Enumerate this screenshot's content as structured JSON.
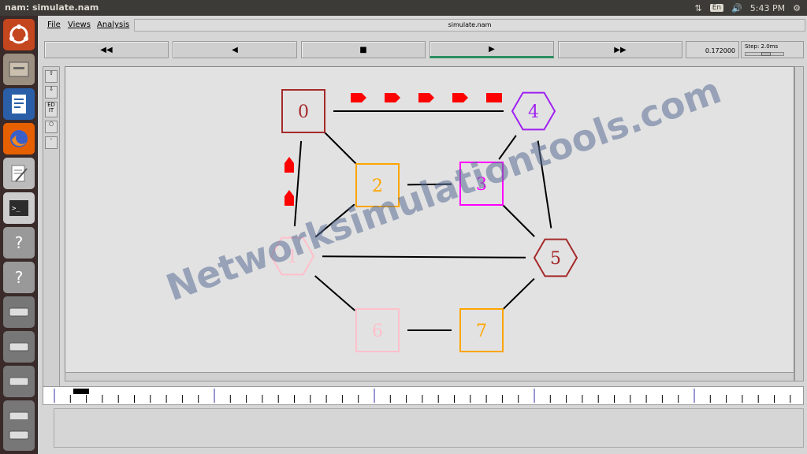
{
  "window_title": "nam: simulate.nam",
  "tray": {
    "keyboard": "En",
    "clock": "5:43 PM"
  },
  "menu": {
    "file": "File",
    "views": "Views",
    "analysis": "Analysis"
  },
  "file_label": "simulate.nam",
  "toolbar": {
    "rewind": "◀◀",
    "back": "◀",
    "stop": "■",
    "play": "▶",
    "fast_forward": "▶▶"
  },
  "time_value": "0.172000",
  "step_label": "Step: 2.0ms",
  "side_tools": {
    "edit": "ED IT"
  },
  "nodes": [
    {
      "id": "0",
      "shape": "square",
      "color": "#a52a2a"
    },
    {
      "id": "1",
      "shape": "hexagon",
      "color": "#ffc0cb"
    },
    {
      "id": "2",
      "shape": "square",
      "color": "#ffa500"
    },
    {
      "id": "3",
      "shape": "square",
      "color": "#ff00ff"
    },
    {
      "id": "4",
      "shape": "hexagon",
      "color": "#a020f0"
    },
    {
      "id": "5",
      "shape": "hexagon",
      "color": "#a52a2a"
    },
    {
      "id": "6",
      "shape": "square",
      "color": "#ffc0cb"
    },
    {
      "id": "7",
      "shape": "square",
      "color": "#ffa500"
    }
  ],
  "links": [
    [
      "0",
      "4"
    ],
    [
      "0",
      "2"
    ],
    [
      "0",
      "1"
    ],
    [
      "2",
      "3"
    ],
    [
      "2",
      "1"
    ],
    [
      "3",
      "4"
    ],
    [
      "3",
      "5"
    ],
    [
      "4",
      "5"
    ],
    [
      "1",
      "5"
    ],
    [
      "1",
      "6"
    ],
    [
      "6",
      "7"
    ],
    [
      "7",
      "5"
    ]
  ],
  "packets": {
    "color": "#ff0000",
    "count_0_to_4": 5,
    "count_1_to_0": 2
  },
  "watermark": "Networksimulationtools.com"
}
